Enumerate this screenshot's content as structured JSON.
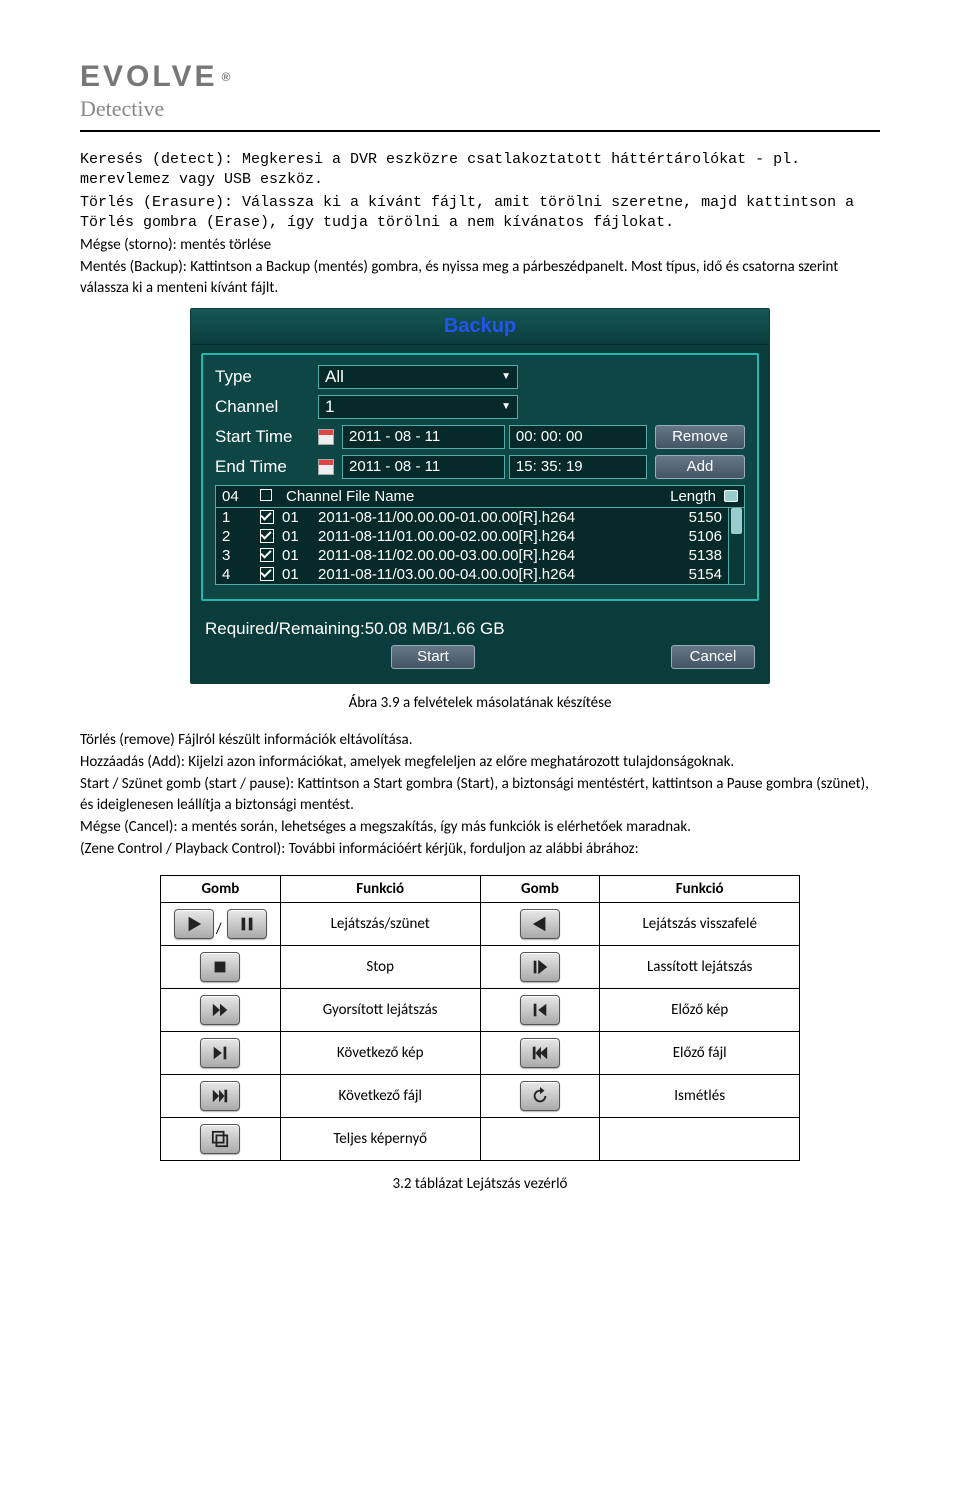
{
  "logo": {
    "main": "EVOLVE",
    "sub": "Detective",
    "reg": "®"
  },
  "intro": {
    "p1": "Keresés (detect): Megkeresi a DVR eszközre csatlakoztatott háttértárolókat - pl. merevlemez vagy USB eszköz.",
    "p2": "Törlés (Erasure): Válassza ki a kívánt fájlt, amit törölni szeretne, majd kattintson a Törlés gombra (Erase), így tudja törölni a nem kívánatos fájlokat.",
    "p3": "Mégse (storno): mentés törlése",
    "p4": "Mentés (Backup): Kattintson a Backup (mentés) gombra, és nyissa meg a párbeszédpanelt. Most típus, idő és csatorna szerint válassza ki a menteni kívánt fájlt."
  },
  "backup": {
    "title": "Backup",
    "labels": {
      "type": "Type",
      "channel": "Channel",
      "start": "Start Time",
      "end": "End Time"
    },
    "type_value": "All",
    "channel_value": "1",
    "start_date": "2011 - 08 - 11",
    "start_time": "00: 00: 00",
    "end_date": "2011 - 08 - 11",
    "end_time": "15: 35: 19",
    "remove_btn": "Remove",
    "add_btn": "Add",
    "header": {
      "count": "04",
      "chfile": "Channel File Name",
      "length": "Length"
    },
    "rows": [
      {
        "idx": "1",
        "checked": true,
        "ch": "01",
        "file": "2011-08-11/00.00.00-01.00.00[R].h264",
        "len": "5150"
      },
      {
        "idx": "2",
        "checked": true,
        "ch": "01",
        "file": "2011-08-11/01.00.00-02.00.00[R].h264",
        "len": "5106"
      },
      {
        "idx": "3",
        "checked": true,
        "ch": "01",
        "file": "2011-08-11/02.00.00-03.00.00[R].h264",
        "len": "5138"
      },
      {
        "idx": "4",
        "checked": true,
        "ch": "01",
        "file": "2011-08-11/03.00.00-04.00.00[R].h264",
        "len": "5154"
      }
    ],
    "reqrem_label": "Required/Remaining:",
    "reqrem_value": "50.08 MB/1.66 GB",
    "start_btn": "Start",
    "cancel_btn": "Cancel"
  },
  "fig_caption": "Ábra 3.9 a felvételek másolatának készítése",
  "after": {
    "p1": "Törlés (remove) Fájlról készült információk eltávolítása.",
    "p2": "Hozzáadás (Add): Kijelzi azon információkat, amelyek megfeleljen az előre meghatározott tulajdonságoknak.",
    "p3": "Start / Szünet gomb (start / pause): Kattintson a Start gombra (Start), a biztonsági mentéstért, kattintson a Pause gombra (szünet), és ideiglenesen leállítja a biztonsági mentést.",
    "p4": "Mégse (Cancel): a mentés során, lehetséges a megszakítás, így más funkciók is elérhetőek maradnak.",
    "p5": "(Zene Control / Playback Control): További információért kérjük, forduljon az alábbi ábrához:"
  },
  "ctrl_header": {
    "btn1": "Gomb",
    "fn1": "Funkció",
    "btn2": "Gomb",
    "fn2": "Funkció"
  },
  "ctrl_rows": [
    {
      "fn1": "Lejátszás/szünet",
      "fn2": "Lejátszás visszafelé"
    },
    {
      "fn1": "Stop",
      "fn2": "Lassított lejátszás"
    },
    {
      "fn1": "Gyorsított lejátszás",
      "fn2": "Előző kép"
    },
    {
      "fn1": "Következő kép",
      "fn2": "Előző fájl"
    },
    {
      "fn1": "Következő fájl",
      "fn2": "Ismétlés"
    },
    {
      "fn1": "Teljes képernyő",
      "fn2": ""
    }
  ],
  "table_caption": "3.2 táblázat Lejátszás vezérlő"
}
